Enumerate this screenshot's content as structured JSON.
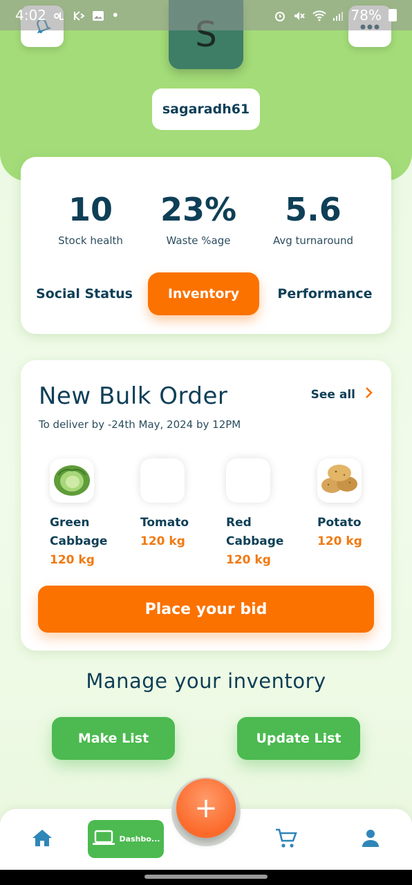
{
  "status_bar": {
    "time": "4:02",
    "battery": "78%"
  },
  "header": {
    "avatar_letter": "S",
    "username": "sagaradh61",
    "bell_icon": "bell-icon",
    "more_icon": "more-icon"
  },
  "stats": [
    {
      "value": "10",
      "label": "Stock health"
    },
    {
      "value": "23%",
      "label": "Waste %age"
    },
    {
      "value": "5.6",
      "label": "Avg turnaround"
    }
  ],
  "tabs": {
    "social": "Social Status",
    "inventory": "Inventory",
    "performance": "Performance",
    "active": "Inventory"
  },
  "order": {
    "title": "New Bulk Order",
    "see_all": "See all",
    "deliver": "To deliver by -24th May, 2024 by 12PM",
    "items": [
      {
        "name": "Green Cabbage",
        "qty": "120 kg",
        "image": "cabbage"
      },
      {
        "name": "Tomato",
        "qty": "120 kg",
        "image": ""
      },
      {
        "name": "Red Cabbage",
        "qty": "120 kg",
        "image": ""
      },
      {
        "name": "Potato",
        "qty": "120 kg",
        "image": "potato"
      }
    ],
    "bid_button": "Place your bid"
  },
  "manage": {
    "title": "Manage your inventory",
    "make_list": "Make List",
    "update_list": "Update List"
  },
  "nav": {
    "dashboard_label": "Dashbo...",
    "fab": "+"
  },
  "colors": {
    "accent_orange": "#fb7200",
    "accent_green": "#4cba50",
    "header_green": "#a3dc78",
    "text_dark": "#0e3f57"
  }
}
